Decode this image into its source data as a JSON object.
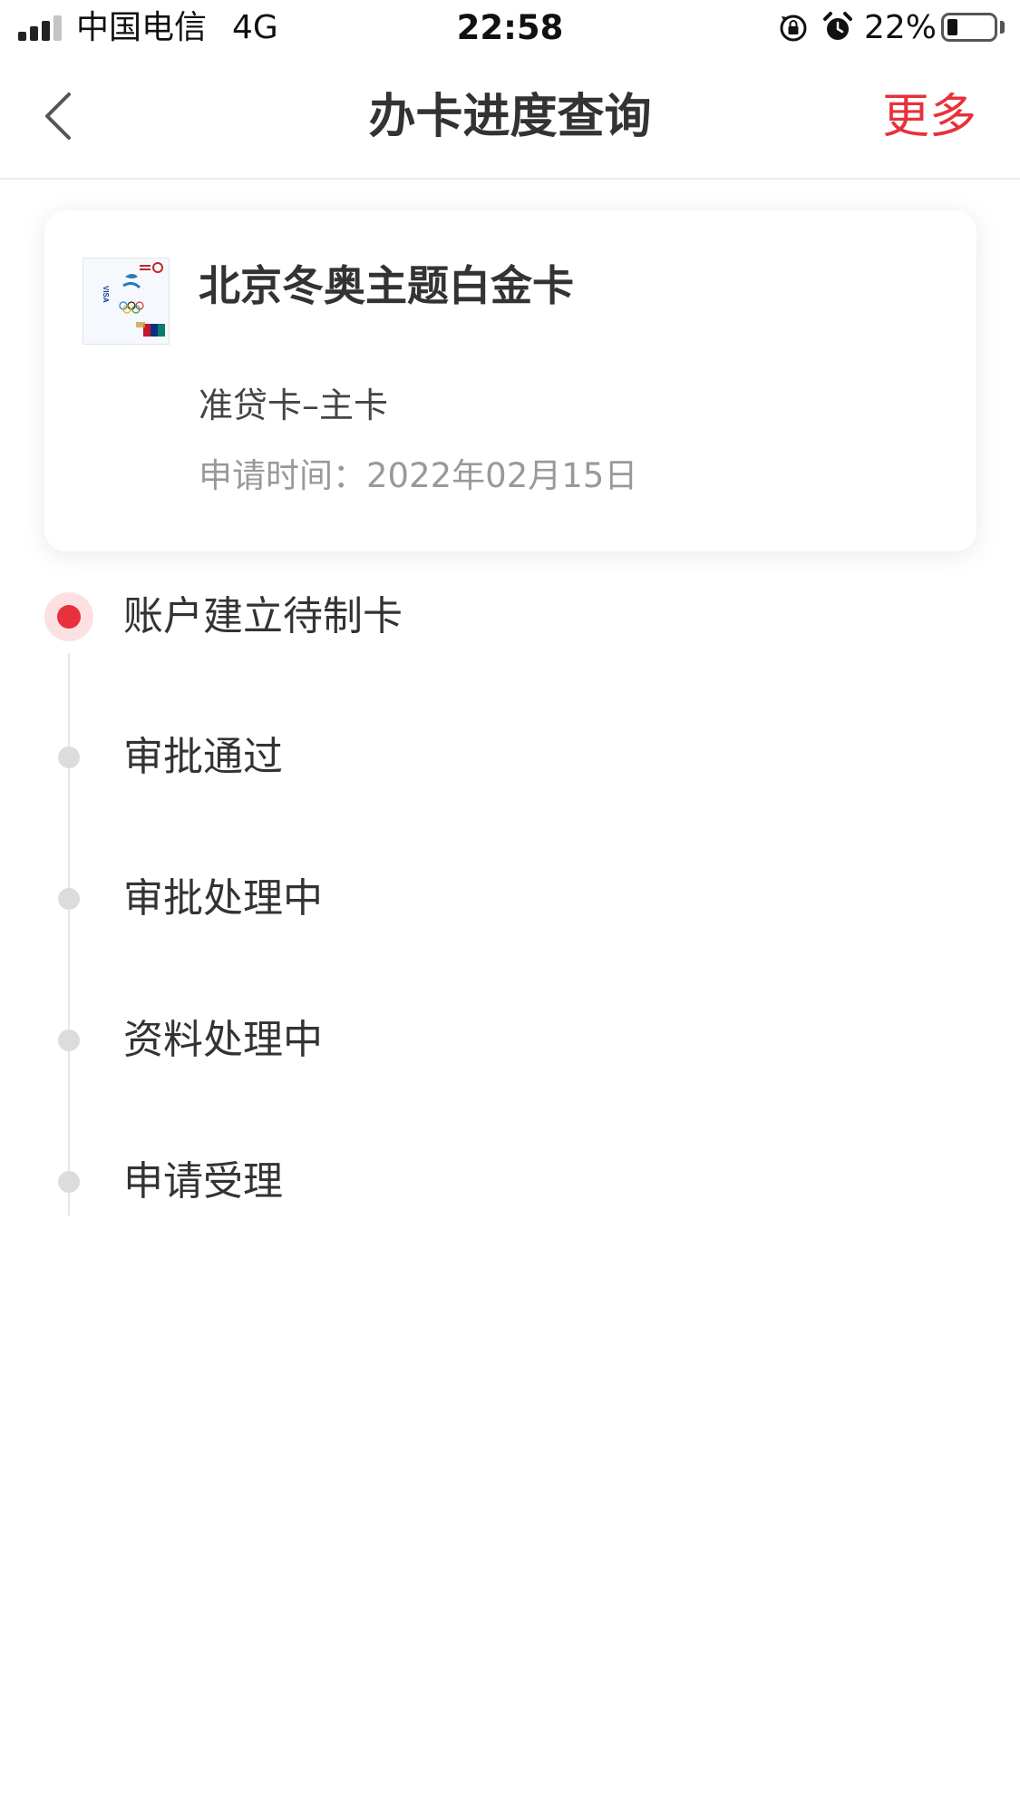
{
  "status_bar": {
    "carrier": "中国电信",
    "network": "4G",
    "time": "22:58",
    "battery_percent": "22%",
    "battery_level": 0.22,
    "icons": [
      "signal-icon",
      "rotation-lock-icon",
      "alarm-icon",
      "battery-icon"
    ]
  },
  "nav": {
    "title": "办卡进度查询",
    "more_label": "更多",
    "back_icon": "chevron-left-icon",
    "accent_color": "#e8313a"
  },
  "card": {
    "name": "北京冬奥主题白金卡",
    "type": "准贷卡–主卡",
    "apply_date": "申请时间：2022年02月15日",
    "image_text": "VISA"
  },
  "timeline": {
    "steps": [
      {
        "label": "账户建立待制卡",
        "active": true
      },
      {
        "label": "审批通过",
        "active": false
      },
      {
        "label": "审批处理中",
        "active": false
      },
      {
        "label": "资料处理中",
        "active": false
      },
      {
        "label": "申请受理",
        "active": false
      }
    ]
  }
}
